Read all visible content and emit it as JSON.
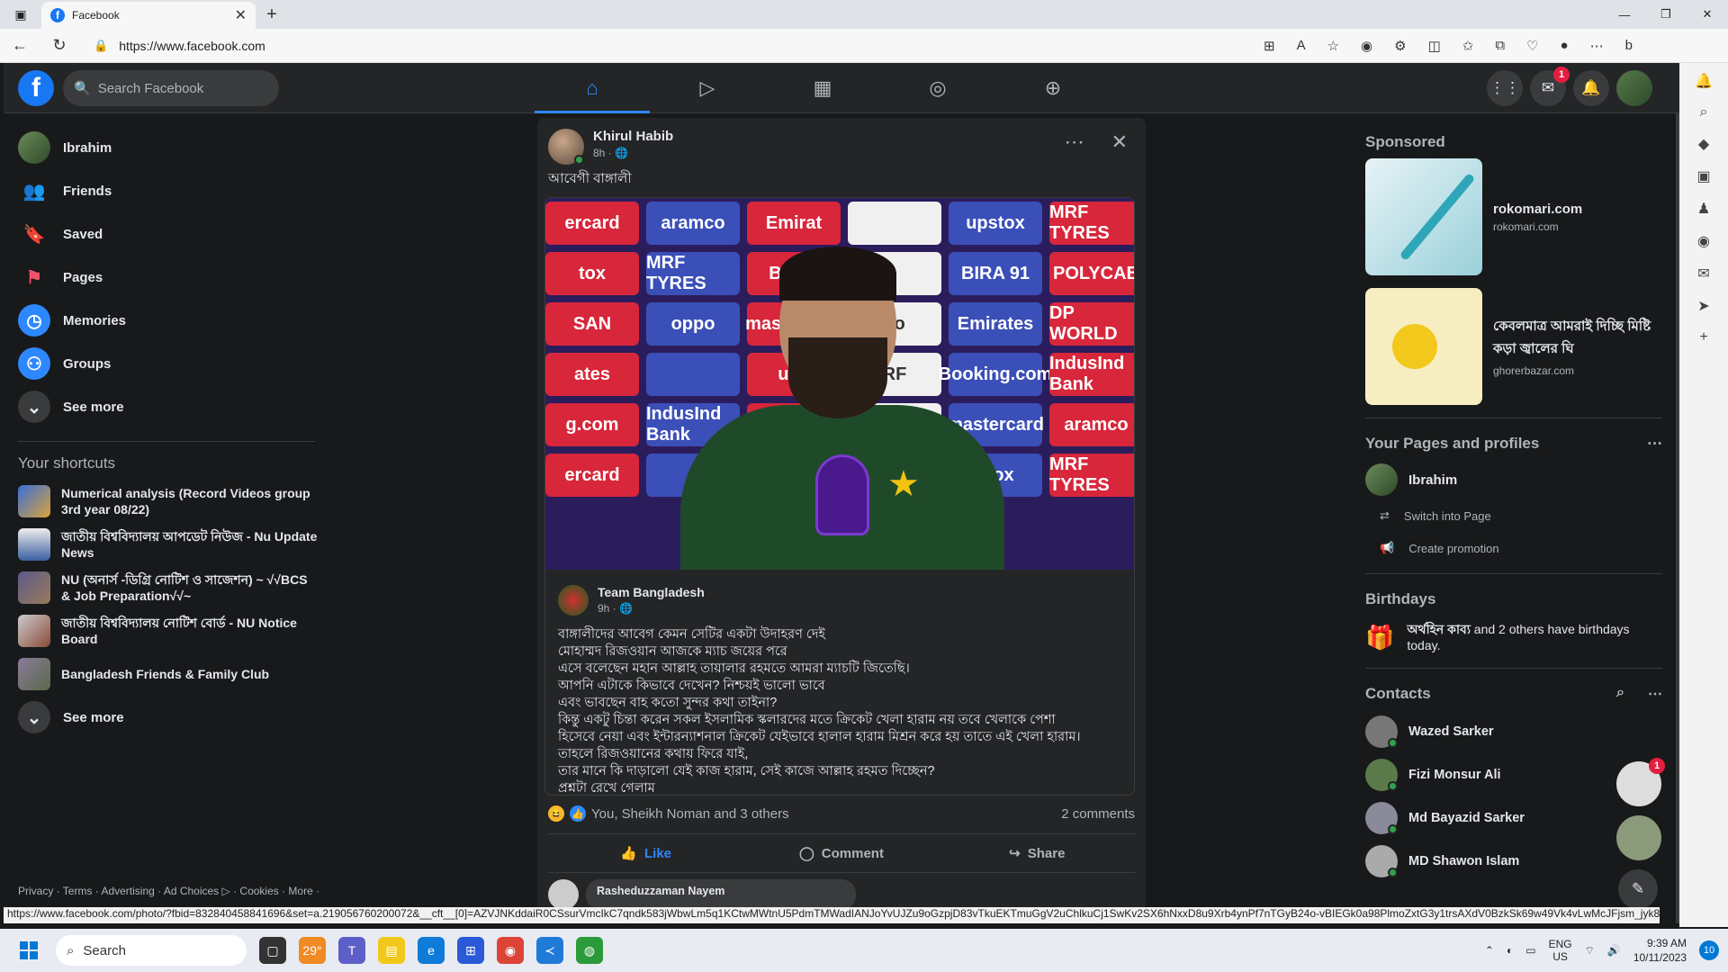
{
  "browser": {
    "tab_title": "Facebook",
    "url": "https://www.facebook.com",
    "status_url": "https://www.facebook.com/photo/?fbid=832840458841696&set=a.219056760200072&__cft__[0]=AZVJNKddaiR0CSsurVmcIkC7qndk583jWbwLm5q1KCtwMWtnU5PdmTMWadIANJoYvUJZu9oGzpjD83vTkuEKTmuGgV2uChlkuCj1SwKv2SX6hNxxD8u9Xrb4ynPf7nTGyB24o-vBIEGk0a98PlmoZxtG3y1trsAXdV0BzkSk69w49Vk4vLwMcJFjsm_jyk8NSvjRLe..."
  },
  "fb": {
    "logo": "f",
    "search_placeholder": "Search Facebook",
    "messenger_badge": "1"
  },
  "left": {
    "items": [
      {
        "label": "Ibrahim"
      },
      {
        "label": "Friends"
      },
      {
        "label": "Saved"
      },
      {
        "label": "Pages"
      },
      {
        "label": "Memories"
      },
      {
        "label": "Groups"
      },
      {
        "label": "See more"
      }
    ],
    "shortcuts_title": "Your shortcuts",
    "shortcuts": [
      {
        "label": "Numerical analysis (Record Videos group 3rd year 08/22)"
      },
      {
        "label": "জাতীয় বিশ্ববিদ্যালয় আপডেট নিউজ - Nu Update News"
      },
      {
        "label": "NU (অনার্স -ডিগ্রি নোটিশ ও সাজেশন) ~ √√BCS & Job Preparation√√~"
      },
      {
        "label": "জাতীয় বিশ্ববিদ্যালয় নোটিশ বোর্ড - NU Notice Board"
      },
      {
        "label": "Bangladesh Friends & Family Club"
      }
    ],
    "see_more2": "See more",
    "footer": "Privacy · Terms · Advertising · Ad Choices ▷ · Cookies · More ·"
  },
  "post": {
    "author": "Khirul Habib",
    "time": "8h · 🌐",
    "text": "আবেগী বাঙ্গালী",
    "shared_author": "Team Bangladesh",
    "shared_time": "9h · 🌐",
    "shared_lines": [
      "বাঙ্গালীদের আবেগ কেমন সেটির একটা উদাহরণ দেই",
      "মোহাম্মদ রিজওয়ান আজকে ম্যাচ জয়ের পরে",
      "এসে বলেছেন মহান আল্লাহ তায়ালার রহমতে আমরা ম্যাচটি জিতেছি।",
      "আপনি এটাকে কিভাবে দেখেন? নিশ্চয়ই ভালো ভাবে",
      "এবং ভাবছেন বাহ কতো সুন্দর কথা তাইনা?",
      "কিন্তু একটু চিন্তা করেন সকল ইসলামিক স্কলারদের মতে ক্রিকেট খেলা হারাম নয় তবে খেলাকে পেশা",
      "হিসেবে নেয়া এবং ইন্টারন্যাশনাল ক্রিকেট যেইভাবে হালাল হারাম মিশ্রন করে হয় তাতে এই খেলা হারাম।",
      "তাহলে রিজওয়ানের কথায় ফিরে যাই,",
      "তার মানে কি দাড়ালো যেই কাজ হারাম, সেই কাজে আল্লাহ রহমত দিচ্ছেন?",
      "প্রশ্নটা রেখে গেলাম"
    ],
    "reactions": "You, Sheikh Noman and 3 others",
    "comments": "2 comments",
    "like": "Like",
    "comment": "Comment",
    "share": "Share",
    "commenter": "Rasheduzzaman Nayem",
    "photo_logos": [
      "ercard",
      "aramco",
      "Emirat",
      "",
      "upstox",
      "MRF TYRES",
      "tox",
      "MRF TYRES",
      "Booki",
      "",
      "BIRA 91",
      "POLYCAB",
      "SAN",
      "oppo",
      "mastercard",
      "co",
      "Emirates",
      "DP WORLD",
      "ates",
      "",
      "ups",
      "RF",
      "Booking.com",
      "IndusInd Bank",
      "g.com",
      "IndusInd Bank",
      "",
      "",
      "mastercard",
      "aramco",
      "ercard",
      "",
      "",
      "",
      "stox",
      "MRF TYRES"
    ]
  },
  "right": {
    "sponsored": "Sponsored",
    "ads": [
      {
        "title": "rokomari.com",
        "sub": "rokomari.com"
      },
      {
        "title": "কেবলমাত্র আমরাই দিচ্ছি মিষ্টি কড়া জ্বালের ঘি",
        "sub": "ghorerbazar.com"
      }
    ],
    "pages_title": "Your Pages and profiles",
    "page_name": "Ibrahim",
    "switch": "Switch into Page",
    "promo": "Create promotion",
    "bday_title": "Birthdays",
    "bday_name": "অর্থহিন কাব্য",
    "bday_rest": " and 2 others have birthdays today.",
    "contacts_title": "Contacts",
    "contacts": [
      "Wazed Sarker",
      "Fizi Monsur Ali",
      "Md Bayazid Sarker",
      "MD Shawon Islam"
    ],
    "chat_badge": "1"
  },
  "taskbar": {
    "search": "Search",
    "weather": "29°",
    "lang1": "ENG",
    "lang2": "US",
    "time": "9:39 AM",
    "date": "10/11/2023",
    "notif": "10"
  }
}
